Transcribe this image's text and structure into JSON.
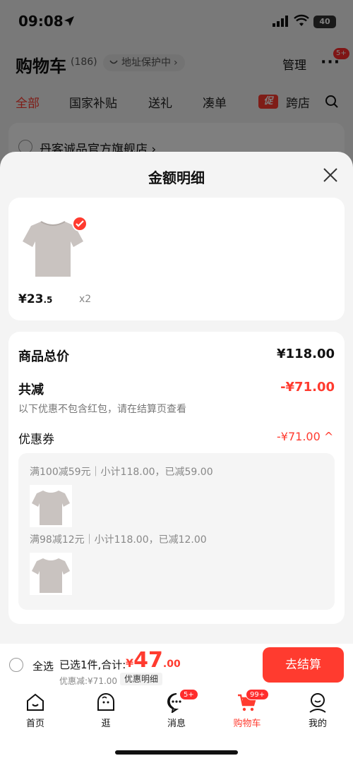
{
  "status": {
    "time": "09:08",
    "battery": "40"
  },
  "header": {
    "title": "购物车",
    "count": "(186)",
    "address_label": "地址保护中",
    "manage": "管理",
    "more_badge": "5+"
  },
  "tabs": [
    {
      "label": "全部"
    },
    {
      "label": "国家补贴"
    },
    {
      "label": "送礼"
    },
    {
      "label": "凑单"
    },
    {
      "label": "跨店",
      "promo": "促"
    }
  ],
  "store": {
    "name": "丹客诚品官方旗舰店"
  },
  "sheet": {
    "title": "金额明细",
    "item": {
      "price_int": "¥23",
      "price_dec": ".5",
      "qty": "x2"
    },
    "summary": {
      "goods_total_label": "商品总价",
      "goods_total_value": "¥118.00",
      "discount_label": "共减",
      "discount_value": "-¥71.00",
      "note": "以下优惠不包含红包，请在结算页查看",
      "coupon_label": "优惠券",
      "coupon_value": "-¥71.00"
    },
    "coupons": [
      {
        "rule": "满100减59元｜小计118.00，已减59.00"
      },
      {
        "rule": "满98减12元｜小计118.00，已减12.00"
      }
    ]
  },
  "bottom_bar": {
    "select_all": "全选",
    "selected_text": "已选1件,合计:",
    "total_currency": "¥",
    "total_int": "47",
    "total_dec": ".00",
    "discount_text": "优惠减:¥71.00",
    "detail_tag": "优惠明细",
    "checkout": "去结算"
  },
  "nav": [
    {
      "label": "首页",
      "icon": "home-icon"
    },
    {
      "label": "逛",
      "icon": "browse-icon"
    },
    {
      "label": "消息",
      "icon": "message-icon",
      "badge": "5+"
    },
    {
      "label": "购物车",
      "icon": "cart-icon",
      "badge": "99+"
    },
    {
      "label": "我的",
      "icon": "profile-icon"
    }
  ],
  "colors": {
    "accent": "#ff3b2f"
  }
}
